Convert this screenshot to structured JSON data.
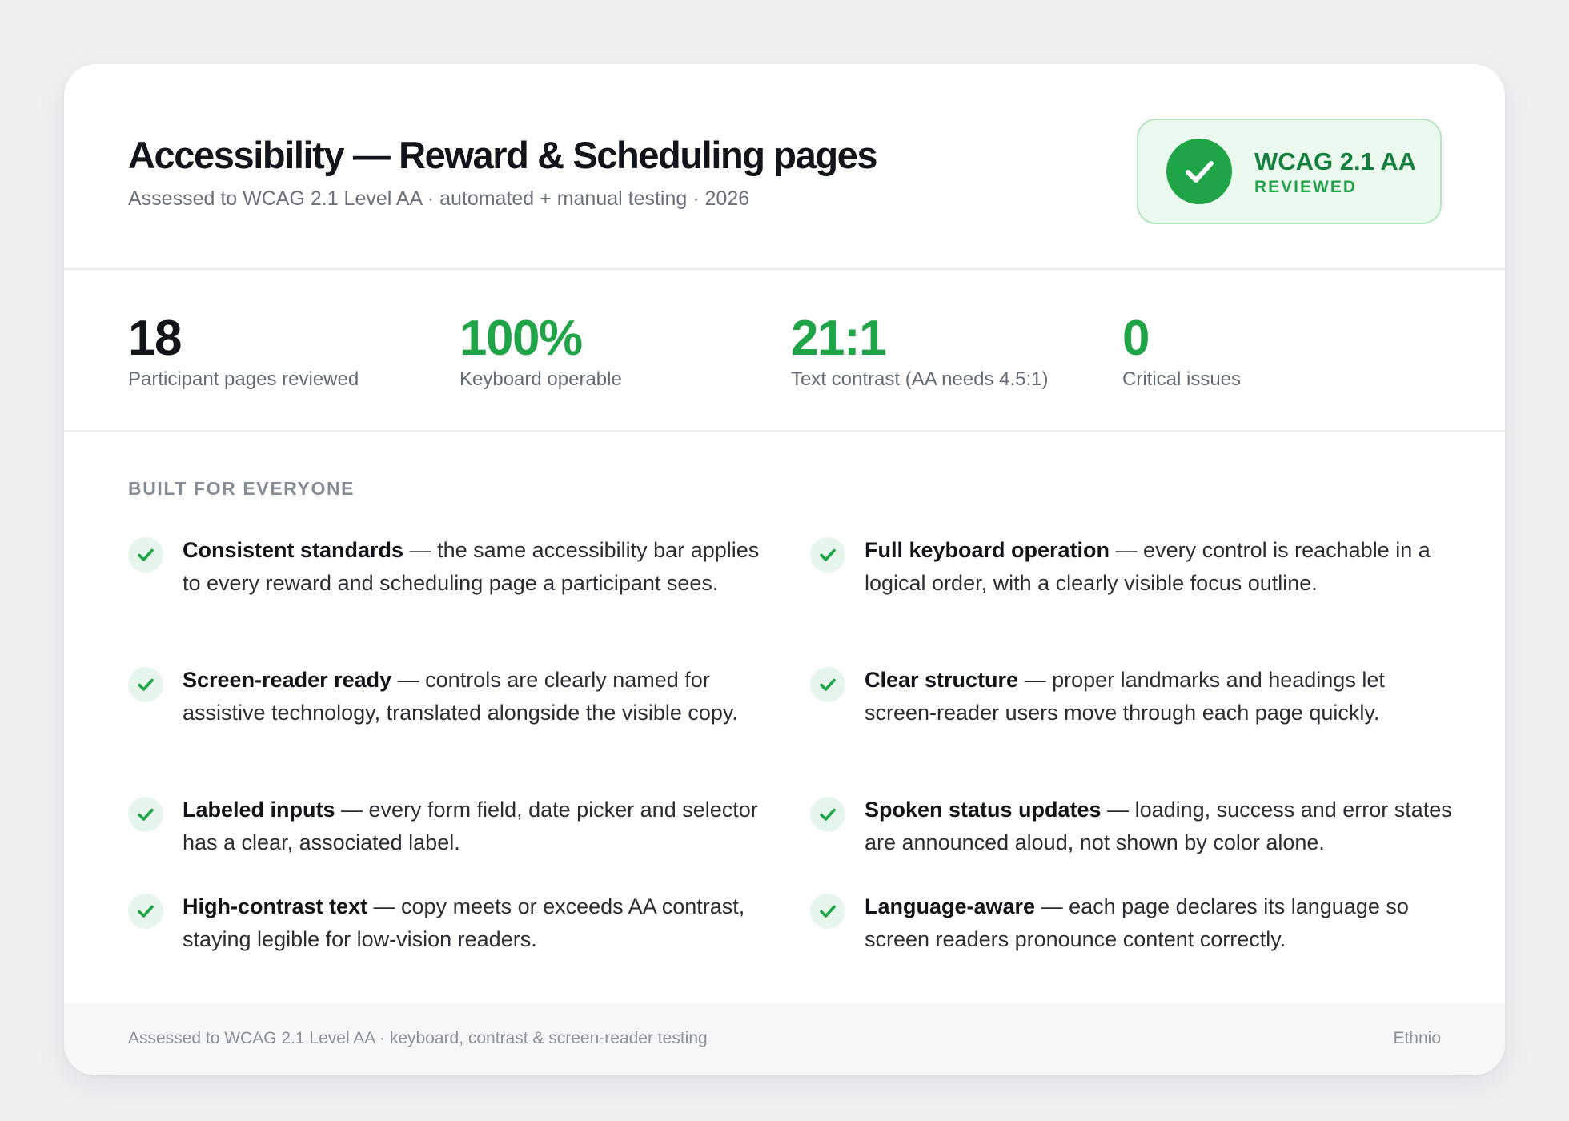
{
  "header": {
    "title": "Accessibility — Reward & Scheduling pages",
    "subtitle": "Assessed to WCAG 2.1 Level AA · automated + manual testing · 2026",
    "badge": {
      "icon": "check-circle-icon",
      "title": "WCAG 2.1 AA",
      "status": "REVIEWED"
    }
  },
  "stats": [
    {
      "value": "18",
      "label": "Participant pages reviewed",
      "color": "#111418"
    },
    {
      "value": "100%",
      "label": "Keyboard operable",
      "color": "#1fa447"
    },
    {
      "value": "21:1",
      "label": "Text contrast (AA needs 4.5:1)",
      "color": "#1fa447"
    },
    {
      "value": "0",
      "label": "Critical issues",
      "color": "#1fa447"
    }
  ],
  "features": {
    "section_label": "BUILT FOR EVERYONE",
    "items": [
      {
        "title": "Consistent standards",
        "body": " — the same accessibility bar applies to every reward and scheduling page a participant sees."
      },
      {
        "title": "Full keyboard operation",
        "body": " — every control is reachable in a logical order, with a clearly visible focus outline."
      },
      {
        "title": "Screen-reader ready",
        "body": " — controls are clearly named for assistive technology, translated alongside the visible copy."
      },
      {
        "title": "Clear structure",
        "body": " — proper landmarks and headings let screen-reader users move through each page quickly."
      },
      {
        "title": "Labeled inputs",
        "body": " — every form field, date picker and selector has a clear, associated label."
      },
      {
        "title": "Spoken status updates",
        "body": " — loading, success and error states are announced aloud, not shown by color alone."
      },
      {
        "title": "High-contrast text",
        "body": " — copy meets or exceeds AA contrast, staying legible for low-vision readers."
      },
      {
        "title": "Language-aware",
        "body": " — each page declares its language so screen readers pronounce content correctly."
      }
    ]
  },
  "footer": {
    "left": "Assessed to WCAG 2.1 Level AA · keyboard, contrast & screen-reader testing",
    "right": "Ethnio"
  },
  "colors": {
    "accent_green": "#1fa447",
    "badge_bg": "#ebf9ee",
    "check_bg": "#e7f6ec"
  }
}
